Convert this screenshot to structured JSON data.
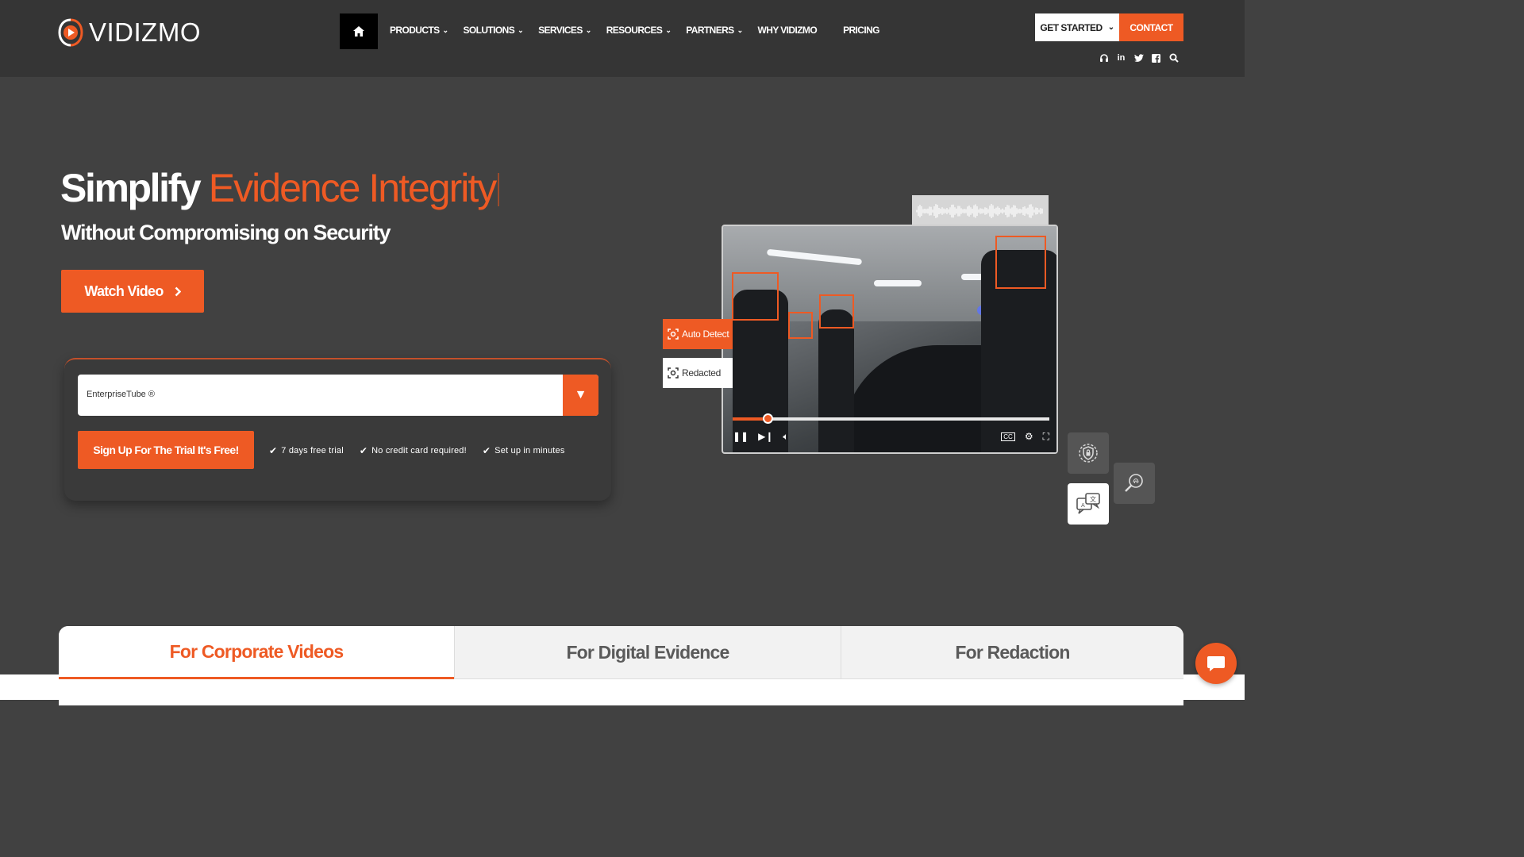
{
  "brand": {
    "name": "VIDIZMO",
    "accent": "#ee5a24",
    "header_bg": "#353535",
    "body_bg": "#414141"
  },
  "nav": {
    "home_icon": "home-icon",
    "items": [
      {
        "label": "PRODUCTS",
        "dropdown": true
      },
      {
        "label": "SOLUTIONS",
        "dropdown": true
      },
      {
        "label": "SERVICES",
        "dropdown": true
      },
      {
        "label": "RESOURCES",
        "dropdown": true
      },
      {
        "label": "PARTNERS",
        "dropdown": true
      },
      {
        "label": "WHY VIDIZMO",
        "dropdown": false
      },
      {
        "label": "PRICING",
        "dropdown": false
      }
    ],
    "get_started": "GET STARTED",
    "contact": "CONTACT",
    "social_icons": [
      "headset-icon",
      "linkedin-icon",
      "twitter-icon",
      "facebook-icon",
      "search-icon"
    ]
  },
  "hero": {
    "title_white": "Simplify",
    "title_orange": "Evidence Integrity",
    "subtitle": "Without Compromising on Security",
    "watch_label": "Watch Video"
  },
  "signup": {
    "selected_product": "EnterpriseTube ®",
    "trial_button": "Sign Up For The Trial It's Free!",
    "checks": [
      "7 days free trial",
      "No credit card required!",
      "Set up in minutes"
    ]
  },
  "video_demo": {
    "auto_detect_label": "Auto Detect",
    "redacted_label": "Redacted",
    "progress": 0.11,
    "feature_icons": [
      "shield-lock-icon",
      "fingerprint-search-icon",
      "translate-chat-icon"
    ]
  },
  "tabs": [
    {
      "label": "For Corporate Videos",
      "active": true
    },
    {
      "label": "For Digital Evidence",
      "active": false
    },
    {
      "label": "For Redaction",
      "active": false
    }
  ]
}
